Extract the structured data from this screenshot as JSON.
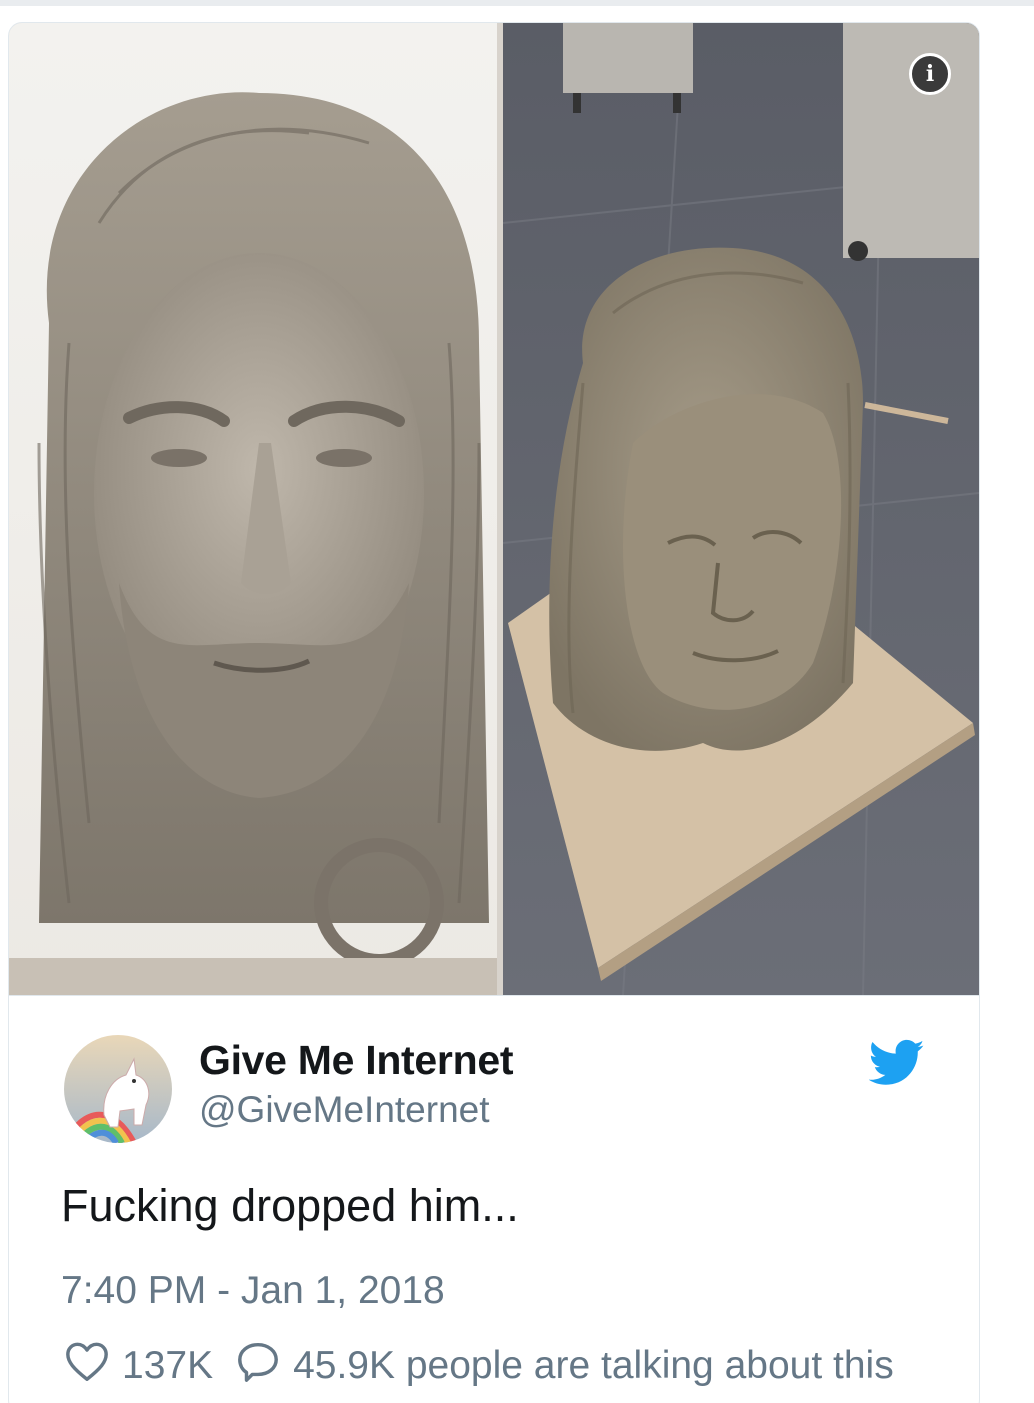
{
  "tweet": {
    "author_name": "Give Me Internet",
    "author_handle": "@GiveMeInternet",
    "text": "Fucking dropped him...",
    "timestamp": "7:40 PM - Jan 1, 2018",
    "likes": "137K",
    "conversation": "45.9K people are talking about this"
  },
  "media": {
    "info_icon": "i"
  },
  "icons": {
    "info": "info-icon",
    "bird": "twitter-bird-icon",
    "heart": "heart-icon",
    "comment": "comment-bubble-icon"
  },
  "colors": {
    "text": "#14171a",
    "secondary": "#657786",
    "twitter_blue": "#1da1f2",
    "border": "#e1e8ed"
  }
}
